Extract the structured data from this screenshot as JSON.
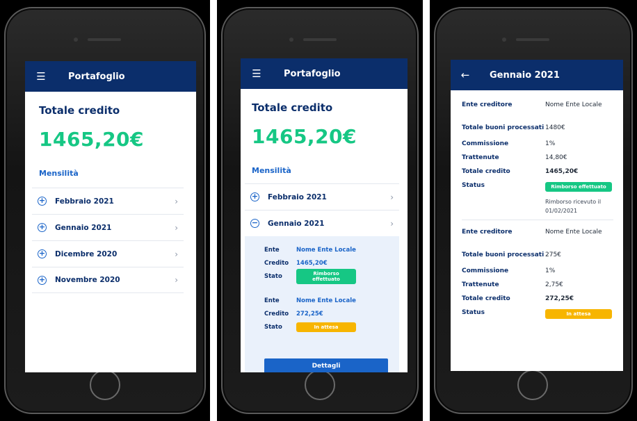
{
  "screen1": {
    "app_title": "Portafoglio",
    "menu_icon": "menu-icon",
    "total_label": "Totale credito",
    "total_amount": "1465,20€",
    "section_label": "Mensilità",
    "months": [
      {
        "label": "Febbraio 2021"
      },
      {
        "label": "Gennaio 2021"
      },
      {
        "label": "Dicembre 2020"
      },
      {
        "label": "Novembre 2020"
      }
    ]
  },
  "screen2": {
    "app_title": "Portafoglio",
    "total_label": "Totale credito",
    "total_amount": "1465,20€",
    "section_label": "Mensilità",
    "months": [
      {
        "label": "Febbraio 2021",
        "expanded": false
      },
      {
        "label": "Gennaio 2021",
        "expanded": true
      }
    ],
    "entries": [
      {
        "ente_label": "Ente",
        "ente_value": "Nome Ente Locale",
        "credito_label": "Credito",
        "credito_value": "1465,20€",
        "stato_label": "Stato",
        "stato_value": "Rimborso effettuato",
        "stato_color": "#16c784"
      },
      {
        "ente_label": "Ente",
        "ente_value": "Nome Ente Locale",
        "credito_label": "Credito",
        "credito_value": "272,25€",
        "stato_label": "Stato",
        "stato_value": "In attesa",
        "stato_color": "#f7b500"
      }
    ],
    "details_button": "Dettagli"
  },
  "screen3": {
    "app_title": "Gennaio 2021",
    "back_icon": "back-arrow-icon",
    "records": [
      {
        "ente_label": "Ente creditore",
        "ente_value": "Nome Ente Locale",
        "buoni_label": "Totale buoni processati",
        "buoni_value": "1480€",
        "commissione_label": "Commissione",
        "commissione_value": "1%",
        "trattenute_label": "Trattenute",
        "trattenute_value": "14,80€",
        "totale_label": "Totale credito",
        "totale_value": "1465,20€",
        "status_label": "Status",
        "status_value": "Rimborso effettuato",
        "status_color": "#16c784",
        "note": "Rimborso ricevuto il 01/02/2021"
      },
      {
        "ente_label": "Ente creditore",
        "ente_value": "Nome Ente Locale",
        "buoni_label": "Totale buoni processati",
        "buoni_value": "275€",
        "commissione_label": "Commissione",
        "commissione_value": "1%",
        "trattenute_label": "Trattenute",
        "trattenute_value": "2,75€",
        "totale_label": "Totale credito",
        "totale_value": "272,25€",
        "status_label": "Status",
        "status_value": "In attesa",
        "status_color": "#f7b500"
      }
    ]
  },
  "colors": {
    "header": "#0b2e6b",
    "accent_green": "#16c784",
    "accent_blue": "#1a64c8",
    "accent_yellow": "#f7b500"
  }
}
